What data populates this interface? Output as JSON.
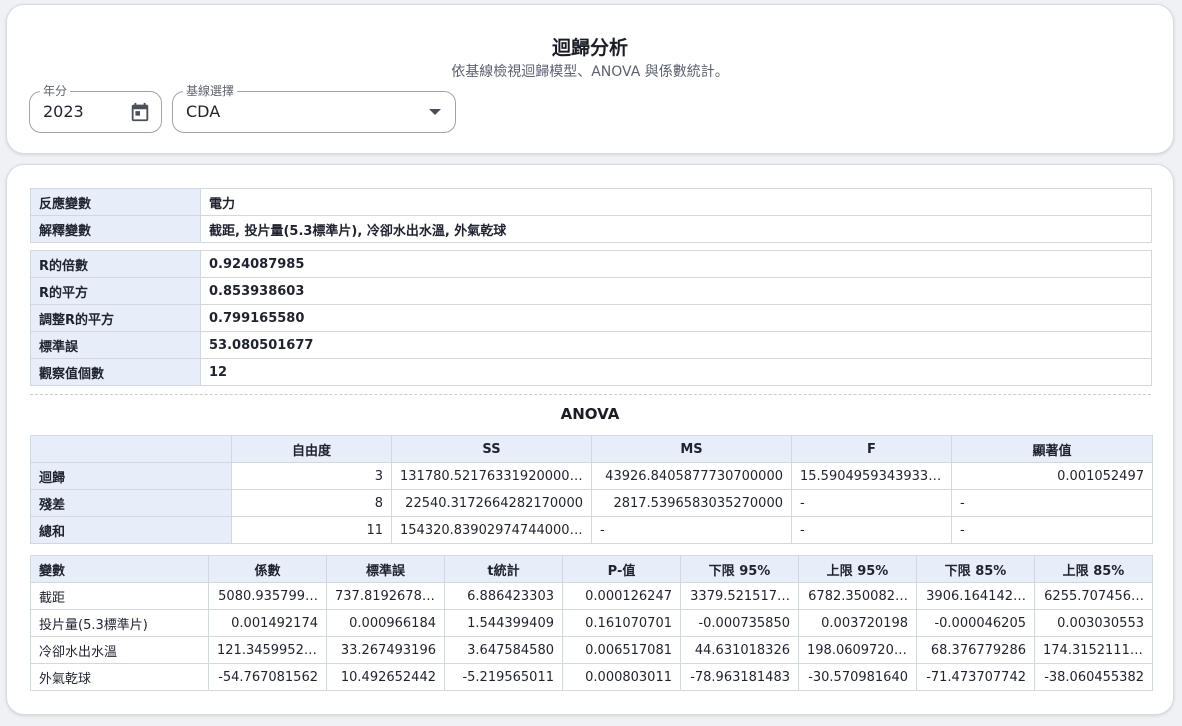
{
  "header": {
    "title": "迴歸分析",
    "subtitle": "依基線檢視迴歸模型、ANOVA 與係數統計。",
    "year_label": "年分",
    "year_value": "2023",
    "baseline_label": "基線選擇",
    "baseline_value": "CDA"
  },
  "variables": {
    "response_label": "反應變數",
    "response_value": "電力",
    "explanatory_label": "解釋變數",
    "explanatory_value": "截距, 投片量(5.3標準片), 冷卻水出水溫, 外氣乾球"
  },
  "stats": {
    "multiple_r_label": "R的倍數",
    "multiple_r_value": "0.924087985",
    "r_squared_label": "R的平方",
    "r_squared_value": "0.853938603",
    "adj_r_squared_label": "調整R的平方",
    "adj_r_squared_value": "0.799165580",
    "std_error_label": "標準誤",
    "std_error_value": "53.080501677",
    "observations_label": "觀察值個數",
    "observations_value": "12"
  },
  "anova": {
    "title": "ANOVA",
    "headers": [
      "",
      "自由度",
      "SS",
      "MS",
      "F",
      "顯著值"
    ],
    "rows": [
      [
        "迴歸",
        "3",
        "131780.5217633192000000",
        "43926.8405877730700000",
        "15.5904959343933150",
        "0.001052497"
      ],
      [
        "殘差",
        "8",
        "22540.3172664282170000",
        "2817.5396583035270000",
        "-",
        "-"
      ],
      [
        "總和",
        "11",
        "154320.8390297474400000",
        "-",
        "-",
        "-"
      ]
    ]
  },
  "coefficients": {
    "headers": [
      "變數",
      "係數",
      "標準誤",
      "t統計",
      "P-值",
      "下限 95%",
      "上限 95%",
      "下限 85%",
      "上限 85%"
    ],
    "rows": [
      [
        "截距",
        "5080.935799…",
        "737.819267823",
        "6.886423303",
        "0.000126247",
        "3379.521517…",
        "6782.350082…",
        "3906.164142…",
        "6255.707456…"
      ],
      [
        "投片量(5.3標準片)",
        "0.001492174",
        "0.000966184",
        "1.544399409",
        "0.161070701",
        "-0.000735850",
        "0.003720198",
        "-0.000046205",
        "0.003030553"
      ],
      [
        "冷卻水出水溫",
        "121.345995204",
        "33.267493196",
        "3.647584580",
        "0.006517081",
        "44.631018326",
        "198.060972083",
        "68.376779286",
        "174.315211123"
      ],
      [
        "外氣乾球",
        "-54.767081562",
        "10.492652442",
        "-5.219565011",
        "0.000803011",
        "-78.963181483",
        "-30.570981640",
        "-71.473707742",
        "-38.060455382"
      ]
    ]
  },
  "icons": {
    "calendar": "calendar-icon",
    "dropdown": "chevron-down-icon"
  },
  "colors": {
    "header_bg": "#e8eef9",
    "border": "#d3d7de"
  }
}
